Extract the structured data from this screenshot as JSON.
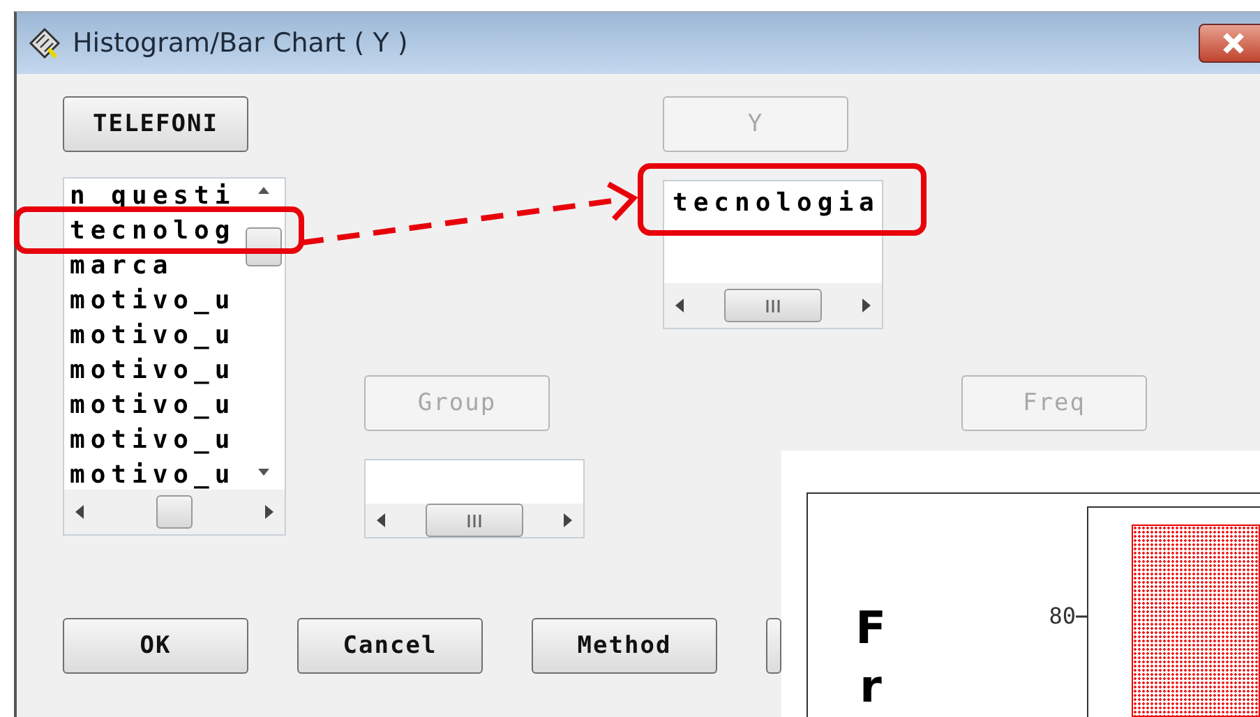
{
  "window": {
    "title": "Histogram/Bar Chart ( Y )"
  },
  "dataset_button": {
    "label": "TELEFONI",
    "disabled": false
  },
  "variables": [
    "n_questi",
    "tecnolog",
    "marca",
    "motivo_u",
    "motivo_u",
    "motivo_u",
    "motivo_u",
    "motivo_u",
    "motivo_u"
  ],
  "y_button": {
    "label": "Y",
    "disabled": true
  },
  "y_list": [
    "tecnologia"
  ],
  "group_button": {
    "label": "Group",
    "disabled": true
  },
  "freq_button": {
    "label": "Freq",
    "disabled": true
  },
  "buttons": [
    "OK",
    "Cancel",
    "Method"
  ],
  "chart_window": {
    "tick": "80",
    "ylabel_letters": [
      "F",
      "r"
    ]
  }
}
